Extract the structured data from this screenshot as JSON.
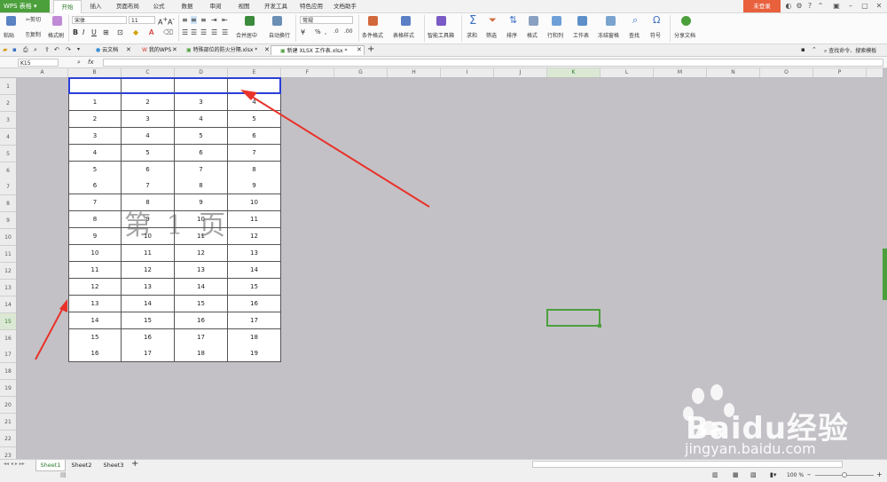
{
  "app": {
    "title": "WPS 表格"
  },
  "menu": {
    "tabs": [
      "开始",
      "插入",
      "页面布局",
      "公式",
      "数据",
      "审阅",
      "视图",
      "开发工具",
      "特色应用",
      "文档助手"
    ],
    "login": "未登录"
  },
  "ribbon": {
    "paste": "粘贴",
    "cut": "剪切",
    "copy": "复制",
    "format_painter": "格式刷",
    "font_name": "宋体",
    "font_size": "11",
    "merge_center": "合并居中",
    "auto_wrap": "自动换行",
    "number_format": "常规",
    "percent": "%",
    "cond_format": "条件格式",
    "table_style": "表格样式",
    "smart_toolbox": "智能工具箱",
    "sum": "求和",
    "filter": "筛选",
    "sort": "排序",
    "format": "格式",
    "rowcol": "行和列",
    "worksheet": "工作表",
    "freeze": "冻结窗格",
    "find": "查找",
    "symbol": "符号",
    "share": "分享文档"
  },
  "doc_tabs": [
    "云文档",
    "我的WPS",
    "特殊部位的防火分隔.xlsx *",
    "新建 XLSX 工作表.xlsx *"
  ],
  "search_cmd": "查找命令、搜索模板",
  "formula_bar": {
    "name_box": "K15",
    "fx": "fx",
    "content": ""
  },
  "columns": [
    "A",
    "B",
    "C",
    "D",
    "E",
    "F",
    "G",
    "H",
    "I",
    "J",
    "K",
    "L",
    "M",
    "N",
    "O",
    "P"
  ],
  "rows": [
    "1",
    "2",
    "3",
    "4",
    "5",
    "6",
    "7",
    "8",
    "9",
    "10",
    "11",
    "12",
    "13",
    "14",
    "15",
    "16",
    "17",
    "18",
    "19",
    "20",
    "21",
    "22",
    "23"
  ],
  "table": [
    [
      "",
      "",
      "",
      ""
    ],
    [
      "1",
      "2",
      "3",
      "4"
    ],
    [
      "2",
      "3",
      "4",
      "5"
    ],
    [
      "3",
      "4",
      "5",
      "6"
    ],
    [
      "4",
      "5",
      "6",
      "7"
    ],
    [
      "5",
      "6",
      "7",
      "8"
    ],
    [
      "6",
      "7",
      "8",
      "9"
    ],
    [
      "7",
      "8",
      "9",
      "10"
    ],
    [
      "8",
      "9",
      "10",
      "11"
    ],
    [
      "9",
      "10",
      "11",
      "12"
    ],
    [
      "10",
      "11",
      "12",
      "13"
    ],
    [
      "11",
      "12",
      "13",
      "14"
    ],
    [
      "12",
      "13",
      "14",
      "15"
    ],
    [
      "13",
      "14",
      "15",
      "16"
    ],
    [
      "14",
      "15",
      "16",
      "17"
    ],
    [
      "15",
      "16",
      "17",
      "18"
    ],
    [
      "16",
      "17",
      "18",
      "19"
    ]
  ],
  "page_watermark": "第 1 页",
  "sheets": [
    "Sheet1",
    "Sheet2",
    "Sheet3"
  ],
  "zoom": "100 %",
  "watermark_logo": "Baidu经验",
  "watermark_url": "jingyan.baidu.com",
  "colors": {
    "accent": "#4ca03c",
    "grid_bg": "#c3c1c6",
    "arrow": "#e8322a",
    "selected_row_border": "#2b3fd8"
  }
}
